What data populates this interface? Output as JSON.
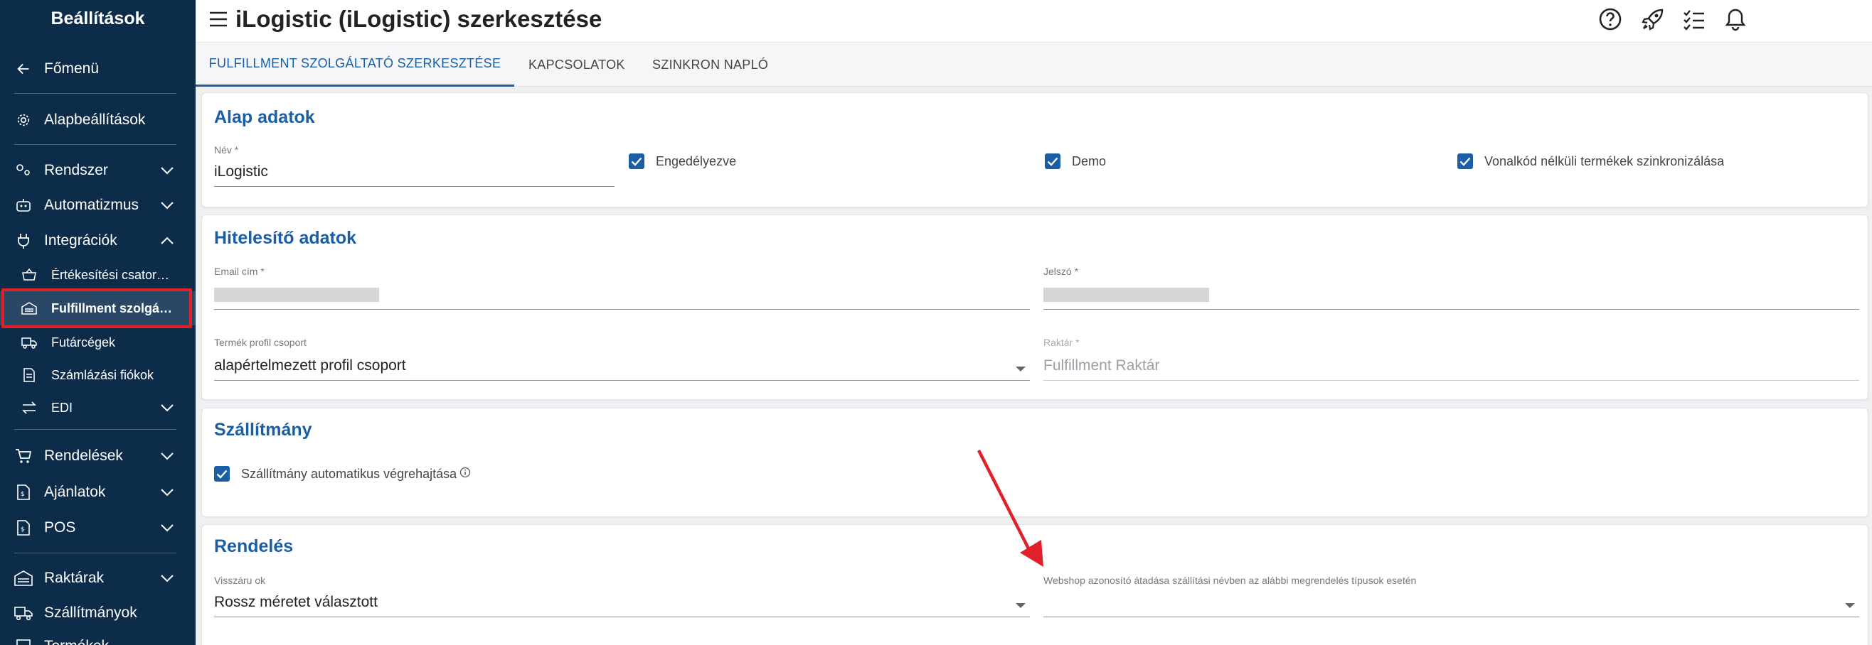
{
  "sidebar": {
    "title": "Beállítások",
    "back": "Főmenü",
    "basic": "Alapbeállítások",
    "system": "Rendszer",
    "automation": "Automatizmus",
    "integrations": "Integrációk",
    "sub": {
      "sales_channels": "Értékesítési csator…",
      "fulfillment": "Fulfillment szolgá…",
      "couriers": "Futárcégek",
      "billing": "Számlázási fiókok",
      "edi": "EDI"
    },
    "orders": "Rendelések",
    "offers": "Ajánlatok",
    "pos": "POS",
    "warehouses": "Raktárak",
    "shipments": "Szállítmányok",
    "products": "Termékek"
  },
  "header": {
    "title": "iLogistic (iLogistic) szerkesztése"
  },
  "tabs": [
    {
      "label": "FULFILLMENT SZOLGÁLTATÓ SZERKESZTÉSE"
    },
    {
      "label": "KAPCSOLATOK"
    },
    {
      "label": "SZINKRON NAPLÓ"
    }
  ],
  "basic": {
    "title": "Alap adatok",
    "name_label": "Név *",
    "name_value": "iLogistic",
    "enabled": "Engedélyezve",
    "demo": "Demo",
    "sync_barcode": "Vonalkód nélküli termékek szinkronizálása"
  },
  "auth": {
    "title": "Hitelesítő adatok",
    "email_label": "Email cím *",
    "password_label": "Jelszó *",
    "profile_label": "Termék profil csoport",
    "profile_value": "alapértelmezett profil csoport",
    "warehouse_label": "Raktár *",
    "warehouse_placeholder": "Fulfillment Raktár"
  },
  "shipment": {
    "title": "Szállítmány",
    "auto_exec": "Szállítmány automatikus végrehajtása"
  },
  "order": {
    "title": "Rendelés",
    "return_label": "Visszáru ok",
    "return_value": "Rossz méretet választott",
    "webshop_label": "Webshop azonosító átadása szállítási névben az alábbi megrendelés típusok esetén",
    "webshop_value": ""
  },
  "colors": {
    "accent": "#1a5fa6",
    "sidebar": "#0d2c4a",
    "highlight": "#e0202a"
  }
}
